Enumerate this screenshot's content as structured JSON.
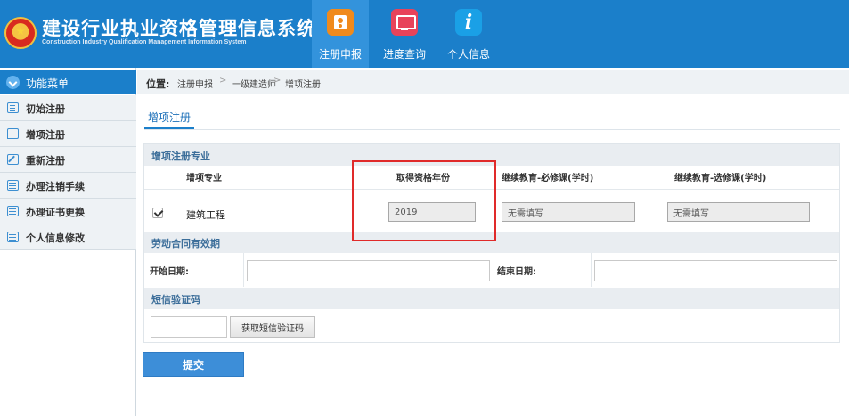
{
  "header": {
    "title": "建设行业执业资格管理信息系统",
    "subtitle": "Construction Industry Qualification Management Information System",
    "nav": [
      {
        "label": "注册申报",
        "icon": "registration-icon",
        "active": true
      },
      {
        "label": "进度查询",
        "icon": "progress-monitor-icon",
        "active": false
      },
      {
        "label": "个人信息",
        "icon": "info-icon",
        "active": false
      }
    ]
  },
  "sidebar": {
    "header": "功能菜单",
    "items": [
      {
        "label": "初始注册",
        "icon": "list-icon"
      },
      {
        "label": "增项注册",
        "icon": "message-icon"
      },
      {
        "label": "重新注册",
        "icon": "edit-icon"
      },
      {
        "label": "办理注销手续",
        "icon": "calendar-icon"
      },
      {
        "label": "办理证书更换",
        "icon": "calendar-icon"
      },
      {
        "label": "个人信息修改",
        "icon": "calendar-icon"
      }
    ]
  },
  "breadcrumb": {
    "lead": "位置:",
    "items": [
      "注册申报",
      "一级建造师",
      "增项注册"
    ],
    "separator": ">"
  },
  "page": {
    "tab": "增项注册",
    "section_major": {
      "title": "增项注册专业",
      "columns": [
        "增项专业",
        "取得资格年份",
        "继续教育-必修课(学时)",
        "继续教育-选修课(学时)"
      ],
      "rows": [
        {
          "checked": true,
          "major": "建筑工程",
          "year": "2019",
          "required": "无需填写",
          "elective": "无需填写"
        }
      ]
    },
    "section_contract": {
      "title": "劳动合同有效期",
      "start_label": "开始日期:",
      "start_value": "",
      "end_label": "结束日期:",
      "end_value": ""
    },
    "section_sms": {
      "title": "短信验证码",
      "code_value": "",
      "button_label": "获取短信验证码"
    },
    "submit_label": "提交"
  },
  "colors": {
    "header_blue": "#1b7fca",
    "highlight_red": "#e02a2a",
    "section_title": "#3c6e9a"
  }
}
